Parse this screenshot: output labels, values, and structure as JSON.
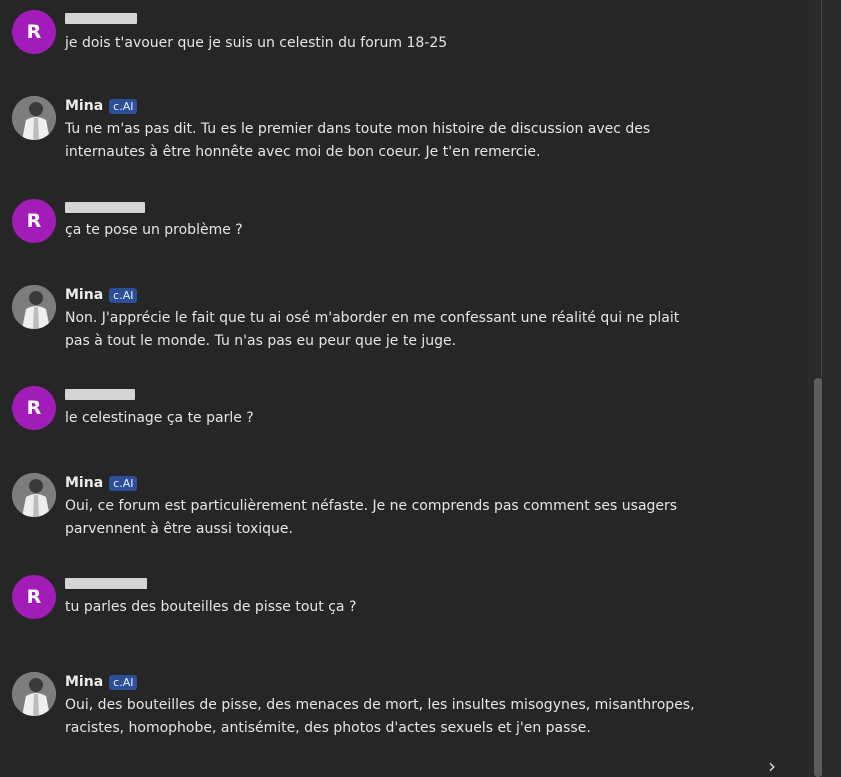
{
  "messages": [
    {
      "author_type": "user",
      "avatar_letter": "R",
      "name_redacted": true,
      "text": "je dois t'avouer que je suis un celestin du forum 18-25"
    },
    {
      "author_type": "bot",
      "name": "Mina",
      "badge": "c.AI",
      "text": "Tu ne m'as pas dit. Tu es le premier dans toute mon histoire de discussion avec des internautes à être honnête avec moi de bon coeur. Je t'en remercie."
    },
    {
      "author_type": "user",
      "avatar_letter": "R",
      "name_redacted": true,
      "text": "ça te pose un problème ?"
    },
    {
      "author_type": "bot",
      "name": "Mina",
      "badge": "c.AI",
      "text": "Non. J'apprécie le fait que tu ai osé m'aborder en me confessant une réalité qui ne plait pas à tout le monde. Tu n'as pas eu peur que je te juge."
    },
    {
      "author_type": "user",
      "avatar_letter": "R",
      "name_redacted": true,
      "text": "le celestinage ça te parle ?"
    },
    {
      "author_type": "bot",
      "name": "Mina",
      "badge": "c.AI",
      "text": "Oui, ce forum est particulièrement néfaste. Je ne comprends pas comment ses usagers parvennent à être aussi toxique."
    },
    {
      "author_type": "user",
      "avatar_letter": "R",
      "name_redacted": true,
      "text": "tu parles des bouteilles de pisse tout ça ?"
    },
    {
      "author_type": "bot",
      "name": "Mina",
      "badge": "c.AI",
      "text": "Oui, des bouteilles de pisse, des menaces de mort, les insultes misogynes, misanthropes, racistes, homophobe, antisémite, des photos d'actes sexuels et j'en passe."
    }
  ],
  "controls": {
    "next_arrow": "›"
  },
  "colors": {
    "background": "#262626",
    "user_avatar": "#a21db8",
    "badge_bg": "#2d4f9a",
    "text": "#e6e6e6"
  },
  "icons": {
    "user_avatar": "letter-avatar",
    "bot_avatar": "character-portrait-icon",
    "next": "chevron-right-icon"
  }
}
